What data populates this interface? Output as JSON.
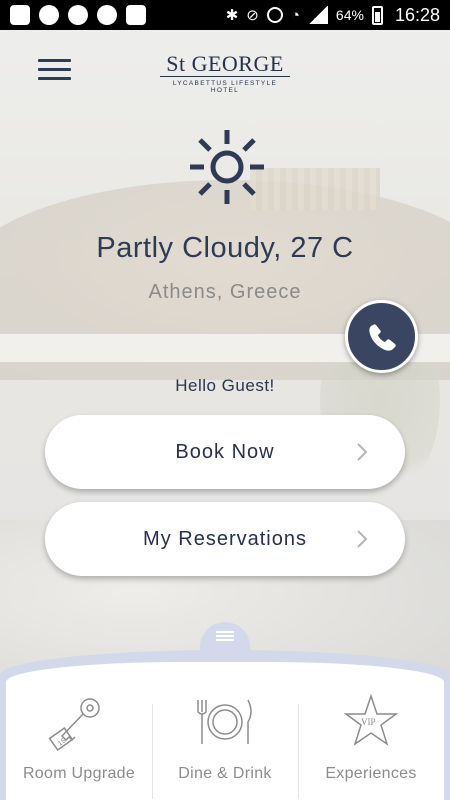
{
  "status_bar": {
    "battery": "64%",
    "time": "16:28",
    "left_icons": [
      "add-icon",
      "messenger-icon",
      "viber-icon",
      "whatsapp-icon",
      "linkedin-icon"
    ],
    "right_icons": [
      "bluetooth-icon",
      "mute-icon",
      "alarm-icon",
      "wifi-icon",
      "signal-icon",
      "battery-icon"
    ]
  },
  "header": {
    "logo_name": "St GEORGE",
    "logo_tagline": "LYCABETTUS LIFESTYLE HOTEL"
  },
  "weather": {
    "condition": "Partly Cloudy, 27 C",
    "location": "Athens, Greece",
    "icon": "sun-icon"
  },
  "greeting": "Hello Guest!",
  "actions": {
    "book_now": "Book Now",
    "my_reservations": "My Reservations"
  },
  "tray": {
    "items": [
      {
        "label": "Room Upgrade",
        "icon": "room-key-icon"
      },
      {
        "label": "Dine & Drink",
        "icon": "plate-cutlery-icon"
      },
      {
        "label": "Experiences",
        "icon": "vip-star-icon"
      }
    ]
  },
  "colors": {
    "navy": "#2f3a55",
    "call_button": "#394561",
    "tray": "#d3d8ea"
  }
}
